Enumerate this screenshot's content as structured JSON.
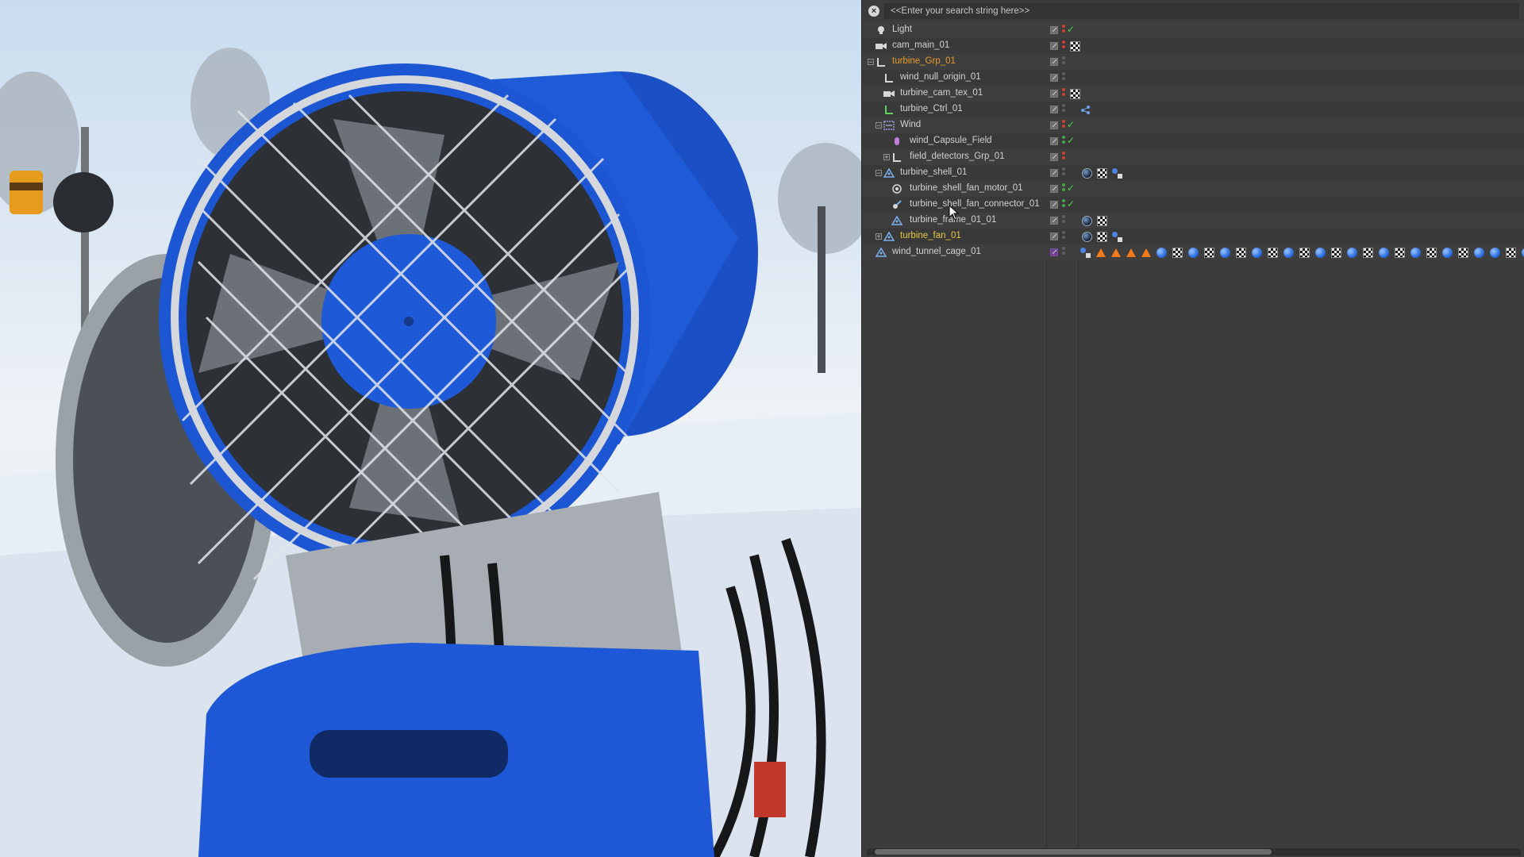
{
  "search": {
    "placeholder": "<<Enter your search string here>>"
  },
  "outliner": {
    "rows": [
      {
        "name": "Light",
        "icon": "light-icon",
        "color": "normal"
      },
      {
        "name": "cam_main_01",
        "icon": "camera-icon",
        "color": "normal"
      },
      {
        "name": "turbine_Grp_01",
        "icon": "null-icon",
        "color": "orange"
      },
      {
        "name": "wind_null_origin_01",
        "icon": "null-icon",
        "color": "normal"
      },
      {
        "name": "turbine_cam_tex_01",
        "icon": "camera-icon",
        "color": "normal"
      },
      {
        "name": "turbine_Ctrl_01",
        "icon": "null-icon",
        "color": "normal"
      },
      {
        "name": "Wind",
        "icon": "wind-icon",
        "color": "normal"
      },
      {
        "name": "wind_Capsule_Field",
        "icon": "capsule-icon",
        "color": "normal"
      },
      {
        "name": "field_detectors_Grp_01",
        "icon": "null-icon",
        "color": "normal"
      },
      {
        "name": "turbine_shell_01",
        "icon": "polygon-icon",
        "color": "normal"
      },
      {
        "name": "turbine_shell_fan_motor_01",
        "icon": "motor-icon",
        "color": "normal"
      },
      {
        "name": "turbine_shell_fan_connector_01",
        "icon": "connector-icon",
        "color": "normal"
      },
      {
        "name": "turbine_frame_01_01",
        "icon": "polygon-icon",
        "color": "normal"
      },
      {
        "name": "turbine_fan_01",
        "icon": "polygon-icon",
        "color": "yellow"
      },
      {
        "name": "wind_tunnel_cage_01",
        "icon": "polygon-icon",
        "color": "normal"
      }
    ]
  },
  "colors": {
    "orange": "#e59a2a",
    "yellow": "#e7c93d",
    "panel": "#3c3c3c"
  }
}
